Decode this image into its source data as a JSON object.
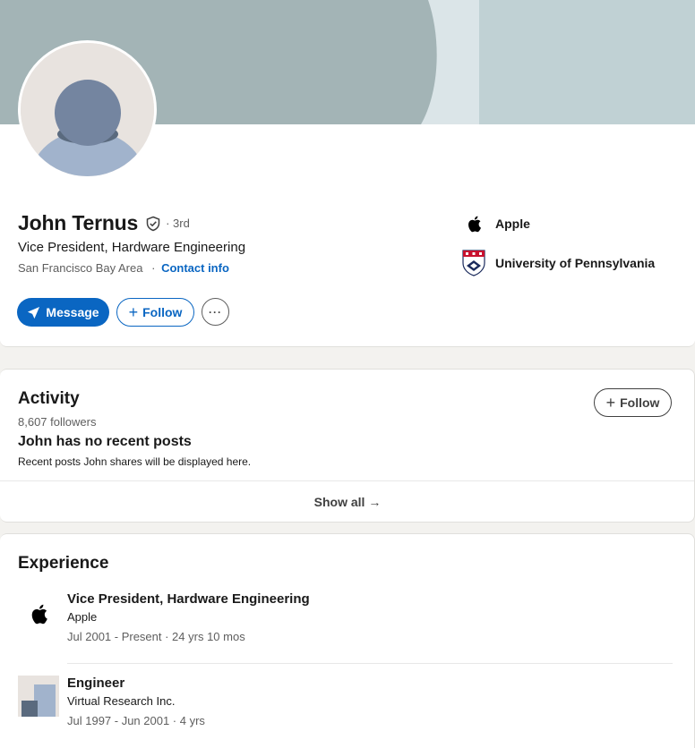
{
  "profile": {
    "name": "John Ternus",
    "degree": "· 3rd",
    "headline": "Vice President, Hardware Engineering",
    "location": "San Francisco Bay Area",
    "location_separator": "·",
    "contact_label": "Contact info",
    "message_label": "Message",
    "follow_label": "Follow",
    "more_label": "···",
    "companies": [
      {
        "name": "Apple",
        "icon": "apple-logo-icon"
      },
      {
        "name": "University of Pennsylvania",
        "icon": "penn-shield-icon"
      }
    ]
  },
  "activity": {
    "title": "Activity",
    "followers": "8,607 followers",
    "follow_label": "Follow",
    "empty_title": "John has no recent posts",
    "empty_desc": "Recent posts John shares will be displayed here.",
    "show_all": "Show all →"
  },
  "experience": {
    "title": "Experience",
    "items": [
      {
        "title": "Vice President, Hardware Engineering",
        "company": "Apple",
        "dates": "Jul 2001 - Present · 24 yrs 10 mos",
        "icon": "apple-logo-icon"
      },
      {
        "title": "Engineer",
        "company": "Virtual Research Inc.",
        "dates": "Jul 1997 - Jun 2001 · 4 yrs",
        "icon": "company-placeholder-icon"
      }
    ]
  },
  "colors": {
    "accent": "#0a66c2",
    "banner_dark": "#a3b4b6",
    "banner_light": "#c0d1d4",
    "page_bg": "#f3f2ef"
  }
}
